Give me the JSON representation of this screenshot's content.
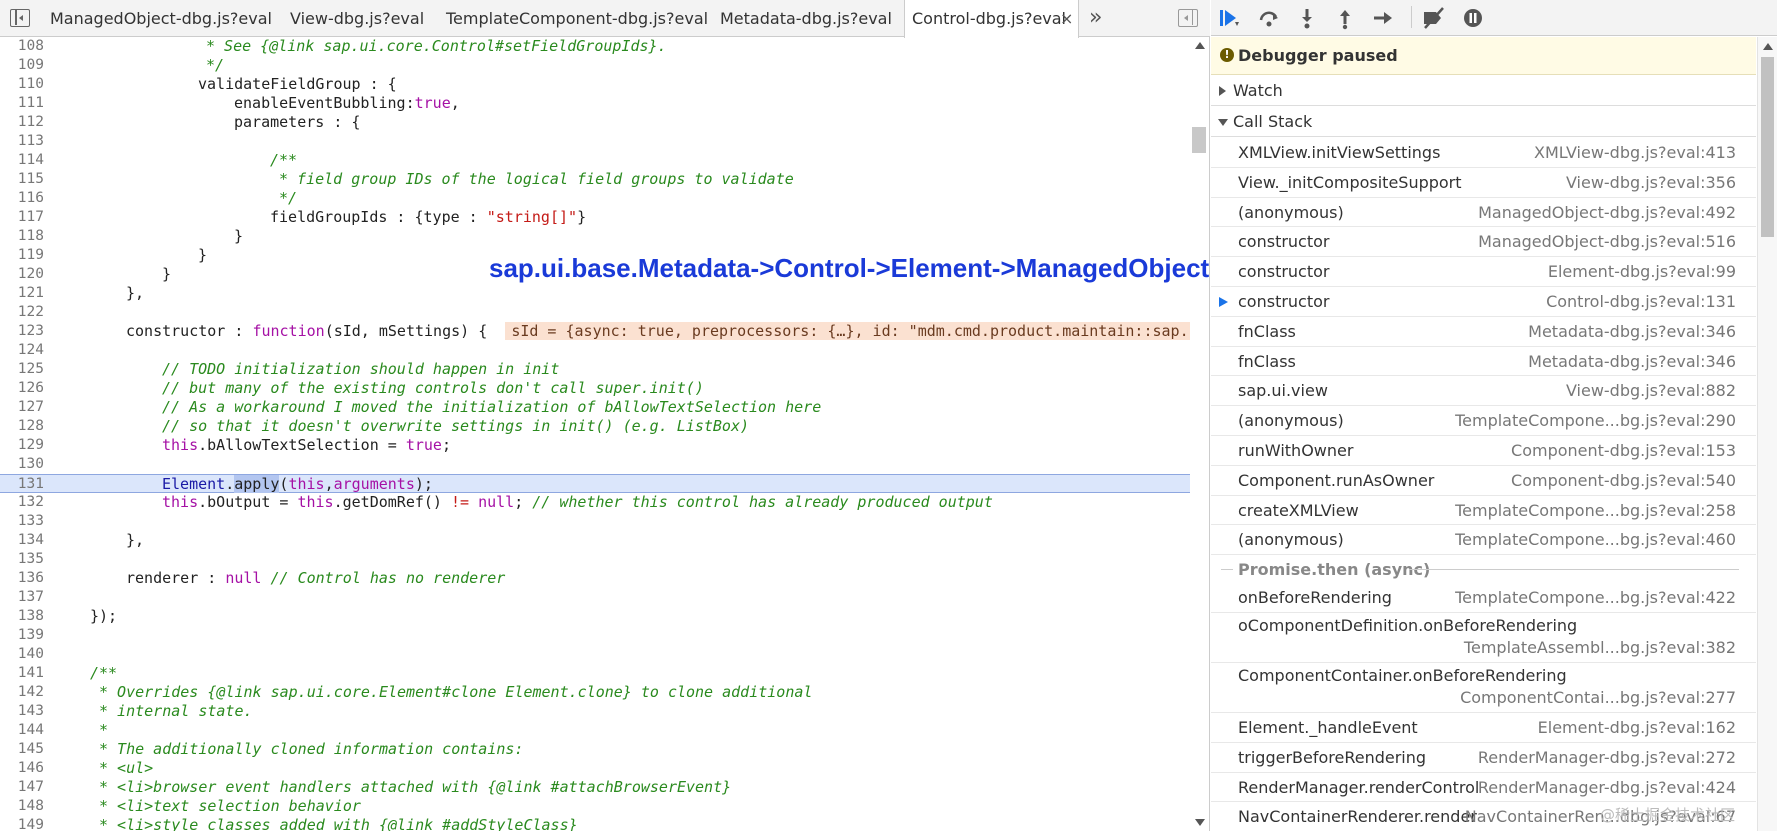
{
  "tabs": [
    {
      "label": "ManagedObject-dbg.js?eval"
    },
    {
      "label": "View-dbg.js?eval"
    },
    {
      "label": "TemplateComponent-dbg.js?eval"
    },
    {
      "label": "Metadata-dbg.js?eval"
    },
    {
      "label": "Control-dbg.js?eval",
      "active": true
    }
  ],
  "tab_close": "×",
  "tab_more": "»",
  "annotation": "sap.ui.base.Metadata->Control->Element->ManagedObject",
  "code_lines": [
    {
      "n": "108"
    },
    {
      "n": "109"
    },
    {
      "n": "110"
    },
    {
      "n": "111"
    },
    {
      "n": "112"
    },
    {
      "n": "113"
    },
    {
      "n": "114"
    },
    {
      "n": "115"
    },
    {
      "n": "116"
    },
    {
      "n": "117"
    },
    {
      "n": "118"
    },
    {
      "n": "119"
    },
    {
      "n": "120"
    },
    {
      "n": "121"
    },
    {
      "n": "122"
    },
    {
      "n": "123"
    },
    {
      "n": "124"
    },
    {
      "n": "125"
    },
    {
      "n": "126"
    },
    {
      "n": "127"
    },
    {
      "n": "128"
    },
    {
      "n": "129"
    },
    {
      "n": "130"
    },
    {
      "n": "131"
    },
    {
      "n": "132"
    },
    {
      "n": "133"
    },
    {
      "n": "134"
    },
    {
      "n": "135"
    },
    {
      "n": "136"
    },
    {
      "n": "137"
    },
    {
      "n": "138"
    },
    {
      "n": "139"
    },
    {
      "n": "140"
    },
    {
      "n": "141"
    },
    {
      "n": "142"
    },
    {
      "n": "143"
    },
    {
      "n": "144"
    },
    {
      "n": "145"
    },
    {
      "n": "146"
    },
    {
      "n": "147"
    },
    {
      "n": "148"
    },
    {
      "n": "149"
    }
  ],
  "code": {
    "l108": "* See {@link sap.ui.core.Control#setFieldGroupIds}.",
    "l109": "*/",
    "l110": "validateFieldGroup : {",
    "l111a": "enableEventBubbling:",
    "l111b": "true",
    "l111c": ",",
    "l112": "parameters : {",
    "l114": "/**",
    "l115": "* field group IDs of the logical field groups to validate",
    "l116": "*/",
    "l117a": "fieldGroupIds : {type : ",
    "l117b": "\"string[]\"",
    "l117c": "}",
    "l118": "}",
    "l119": "}",
    "l120": "}",
    "l121": "},",
    "l123a": "constructor : ",
    "l123b": "function",
    "l123c": "(sId, mSettings) {",
    "l123d": "sId = {async: true, preprocessors: {…}, id: \"mdm.cmd.product.maintain::sap.",
    "l125": "// TODO initialization should happen in init",
    "l126": "// but many of the existing controls don't call super.init()",
    "l127": "// As a workaround I moved the initialization of bAllowTextSelection here",
    "l128": "// so that it doesn't overwrite settings in init() (e.g. ListBox)",
    "l129a": "this",
    "l129b": ".bAllowTextSelection = ",
    "l129c": "true",
    "l129d": ";",
    "l131a": "Element",
    "l131b": ".",
    "l131c": "apply",
    "l131d": "(",
    "l131e": "this",
    "l131f": ",",
    "l131g": "arguments",
    "l131h": ");",
    "l132a": "this",
    "l132b": ".bOutput = ",
    "l132c": "this",
    "l132d": ".getDomRef() ",
    "l132e": "!=",
    "l132f": " ",
    "l132g": "null",
    "l132h": "; ",
    "l132i": "// whether this control has already produced output",
    "l134": "},",
    "l136a": "renderer : ",
    "l136b": "null",
    "l136c": " // Control has no renderer",
    "l138": "});",
    "l141": "/**",
    "l142": "* Overrides {@link sap.ui.core.Element#clone Element.clone} to clone additional",
    "l143": "* internal state.",
    "l144": "*",
    "l145": "* The additionally cloned information contains:",
    "l146": "* <ul>",
    "l147": "* <li>browser event handlers attached with {@link #attachBrowserEvent}",
    "l148": "* <li>text selection behavior",
    "l149": "* <li>style classes added with {@link #addStyleClass}"
  },
  "debugger": {
    "paused_icon": "!",
    "paused_text": "Debugger paused",
    "watch_label": "Watch",
    "callstack_label": "Call Stack",
    "frames": [
      {
        "fn": "XMLView.initViewSettings",
        "loc": "XMLView-dbg.js?eval:413"
      },
      {
        "fn": "View._initCompositeSupport",
        "loc": "View-dbg.js?eval:356"
      },
      {
        "fn": "(anonymous)",
        "loc": "ManagedObject-dbg.js?eval:492"
      },
      {
        "fn": "constructor",
        "loc": "ManagedObject-dbg.js?eval:516"
      },
      {
        "fn": "constructor",
        "loc": "Element-dbg.js?eval:99"
      },
      {
        "fn": "constructor",
        "loc": "Control-dbg.js?eval:131"
      },
      {
        "fn": "fnClass",
        "loc": "Metadata-dbg.js?eval:346"
      },
      {
        "fn": "fnClass",
        "loc": "Metadata-dbg.js?eval:346"
      },
      {
        "fn": "sap.ui.view",
        "loc": "View-dbg.js?eval:882"
      },
      {
        "fn": "(anonymous)",
        "loc": "TemplateCompone...bg.js?eval:290"
      },
      {
        "fn": "runWithOwner",
        "loc": "Component-dbg.js?eval:153"
      },
      {
        "fn": "Component.runAsOwner",
        "loc": "Component-dbg.js?eval:540"
      },
      {
        "fn": "createXMLView",
        "loc": "TemplateCompone...bg.js?eval:258"
      },
      {
        "fn": "(anonymous)",
        "loc": "TemplateCompone...bg.js?eval:460"
      }
    ],
    "async_label": "Promise.then (async)",
    "frames2": [
      {
        "fn": "onBeforeRendering",
        "loc": "TemplateCompone...bg.js?eval:422"
      },
      {
        "fn": "oComponentDefinition.onBeforeRendering",
        "loc": "TemplateAssembl...bg.js?eval:382"
      },
      {
        "fn": "ComponentContainer.onBeforeRendering",
        "loc": "ComponentContai...bg.js?eval:277"
      },
      {
        "fn": "Element._handleEvent",
        "loc": "Element-dbg.js?eval:162"
      },
      {
        "fn": "triggerBeforeRendering",
        "loc": "RenderManager-dbg.js?eval:272"
      },
      {
        "fn": "RenderManager.renderControl",
        "loc": "RenderManager-dbg.js?eval:424"
      },
      {
        "fn": "NavContainerRenderer.render",
        "loc": "NavContainerRen...dbg.js?eval:67"
      }
    ]
  },
  "watermark": "@稀土掘金技术社区",
  "colors": {
    "accent": "#1a73e8",
    "annotation": "#1a3ad8",
    "current_line": "#dbe6fb"
  }
}
